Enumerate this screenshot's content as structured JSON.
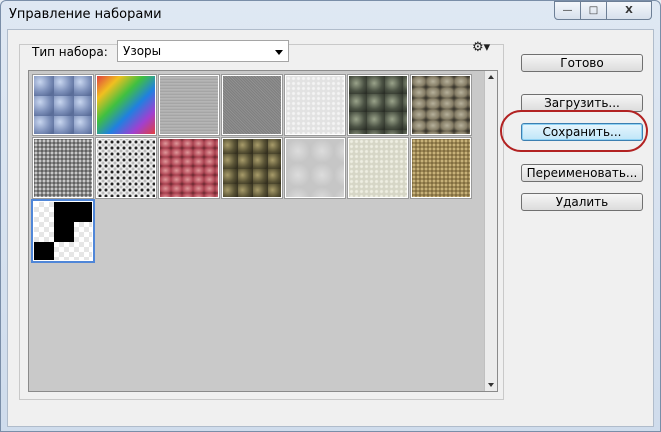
{
  "window": {
    "title": "Управление наборами",
    "controls": [
      "minimize-icon",
      "restore-icon",
      "close-icon"
    ]
  },
  "preset": {
    "type_label": "Тип набора:",
    "type_value": "Узоры",
    "menu_icon": "gear-icon"
  },
  "patterns": [
    "blue-bubbles",
    "rainbow-gradient",
    "fine-gray-noise",
    "dark-gray-noise",
    "white-plaster",
    "dark-rock",
    "gray-pebbles",
    "gravel",
    "granite",
    "red-leaves",
    "moss-rock",
    "light-stone",
    "pale-stone",
    "tan-grass",
    "transparent-checker"
  ],
  "selected_pattern": "transparent-checker",
  "buttons": {
    "done": "Готово",
    "load": "Загрузить...",
    "save": "Сохранить...",
    "rename": "Переименовать...",
    "delete": "Удалить"
  },
  "colors": {
    "highlight": "#b22222",
    "focus": "#3c7fb1",
    "panel": "#c9c9c9"
  }
}
